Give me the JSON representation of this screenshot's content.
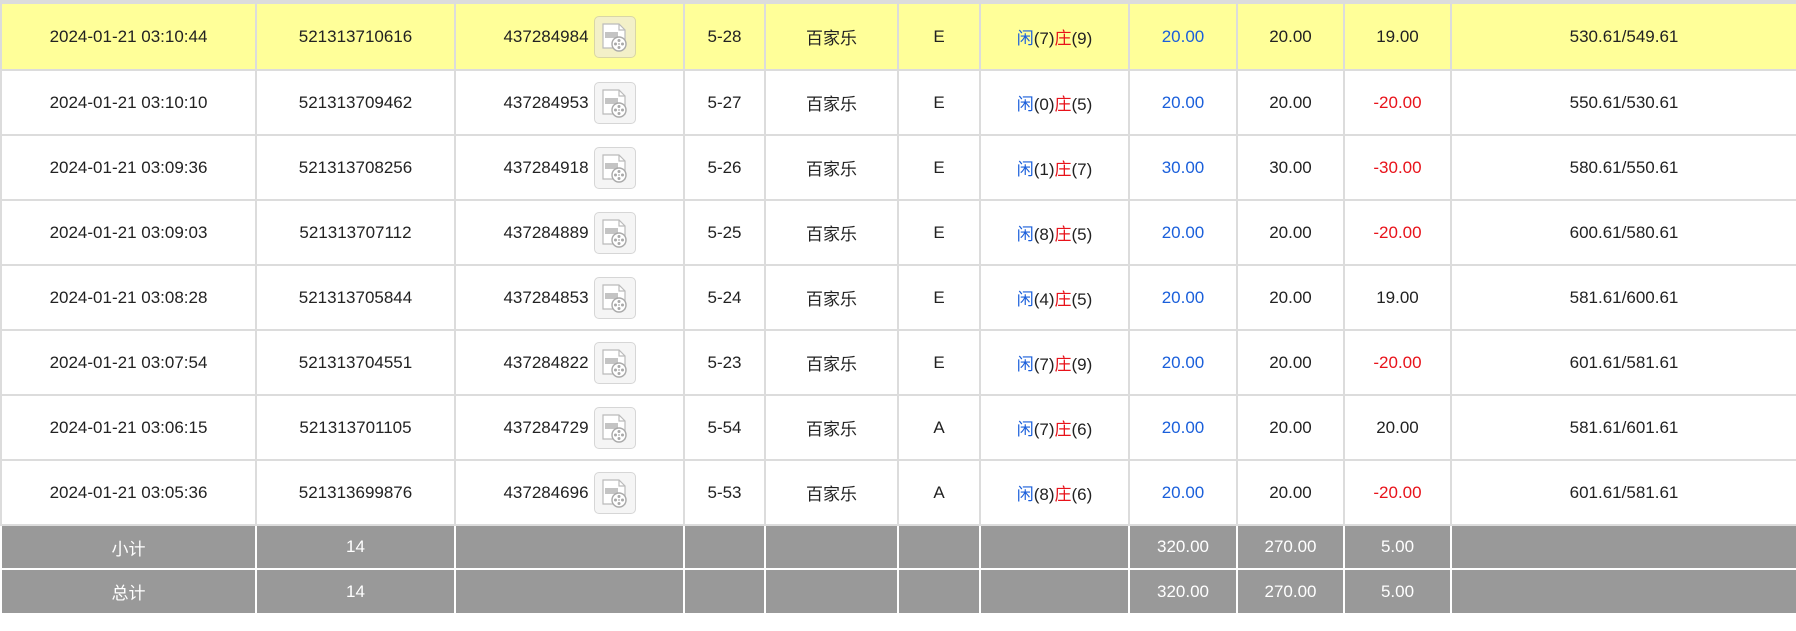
{
  "colors": {
    "player": "#1a5fdb",
    "banker": "#e8121a",
    "highlight": "#ffff99",
    "total_bg": "#999999"
  },
  "rows": [
    {
      "time": "2024-01-21 03:10:44",
      "order_no": "521313710616",
      "game_no": "437284984",
      "icon": "film-reel-icon",
      "round": "5-28",
      "game": "百家乐",
      "table": "E",
      "player_label": "闲",
      "player_pts": "(7)",
      "banker_label": "庄",
      "banker_pts": "(9)",
      "bet": "20.00",
      "valid": "20.00",
      "win": "19.00",
      "win_color": "normal",
      "balance": "530.61/549.61",
      "highlight": true
    },
    {
      "time": "2024-01-21 03:10:10",
      "order_no": "521313709462",
      "game_no": "437284953",
      "icon": "film-reel-icon",
      "round": "5-27",
      "game": "百家乐",
      "table": "E",
      "player_label": "闲",
      "player_pts": "(0)",
      "banker_label": "庄",
      "banker_pts": "(5)",
      "bet": "20.00",
      "valid": "20.00",
      "win": "-20.00",
      "win_color": "red",
      "balance": "550.61/530.61"
    },
    {
      "time": "2024-01-21 03:09:36",
      "order_no": "521313708256",
      "game_no": "437284918",
      "icon": "film-reel-icon",
      "round": "5-26",
      "game": "百家乐",
      "table": "E",
      "player_label": "闲",
      "player_pts": "(1)",
      "banker_label": "庄",
      "banker_pts": "(7)",
      "bet": "30.00",
      "valid": "30.00",
      "win": "-30.00",
      "win_color": "red",
      "balance": "580.61/550.61"
    },
    {
      "time": "2024-01-21 03:09:03",
      "order_no": "521313707112",
      "game_no": "437284889",
      "icon": "film-reel-icon",
      "round": "5-25",
      "game": "百家乐",
      "table": "E",
      "player_label": "闲",
      "player_pts": "(8)",
      "banker_label": "庄",
      "banker_pts": "(5)",
      "bet": "20.00",
      "valid": "20.00",
      "win": "-20.00",
      "win_color": "red",
      "balance": "600.61/580.61"
    },
    {
      "time": "2024-01-21 03:08:28",
      "order_no": "521313705844",
      "game_no": "437284853",
      "icon": "film-reel-icon",
      "round": "5-24",
      "game": "百家乐",
      "table": "E",
      "player_label": "闲",
      "player_pts": "(4)",
      "banker_label": "庄",
      "banker_pts": "(5)",
      "bet": "20.00",
      "valid": "20.00",
      "win": "19.00",
      "win_color": "normal",
      "balance": "581.61/600.61"
    },
    {
      "time": "2024-01-21 03:07:54",
      "order_no": "521313704551",
      "game_no": "437284822",
      "icon": "film-reel-icon",
      "round": "5-23",
      "game": "百家乐",
      "table": "E",
      "player_label": "闲",
      "player_pts": "(7)",
      "banker_label": "庄",
      "banker_pts": "(9)",
      "bet": "20.00",
      "valid": "20.00",
      "win": "-20.00",
      "win_color": "red",
      "balance": "601.61/581.61"
    },
    {
      "time": "2024-01-21 03:06:15",
      "order_no": "521313701105",
      "game_no": "437284729",
      "icon": "film-reel-icon",
      "round": "5-54",
      "game": "百家乐",
      "table": "A",
      "player_label": "闲",
      "player_pts": "(7)",
      "banker_label": "庄",
      "banker_pts": "(6)",
      "bet": "20.00",
      "valid": "20.00",
      "win": "20.00",
      "win_color": "normal",
      "balance": "581.61/601.61"
    },
    {
      "time": "2024-01-21 03:05:36",
      "order_no": "521313699876",
      "game_no": "437284696",
      "icon": "film-reel-icon",
      "round": "5-53",
      "game": "百家乐",
      "table": "A",
      "player_label": "闲",
      "player_pts": "(8)",
      "banker_label": "庄",
      "banker_pts": "(6)",
      "bet": "20.00",
      "valid": "20.00",
      "win": "-20.00",
      "win_color": "red",
      "balance": "601.61/581.61"
    }
  ],
  "subtotal": {
    "label": "小计",
    "count": "14",
    "bet": "320.00",
    "valid": "270.00",
    "win": "5.00"
  },
  "total": {
    "label": "总计",
    "count": "14",
    "bet": "320.00",
    "valid": "270.00",
    "win": "5.00"
  }
}
